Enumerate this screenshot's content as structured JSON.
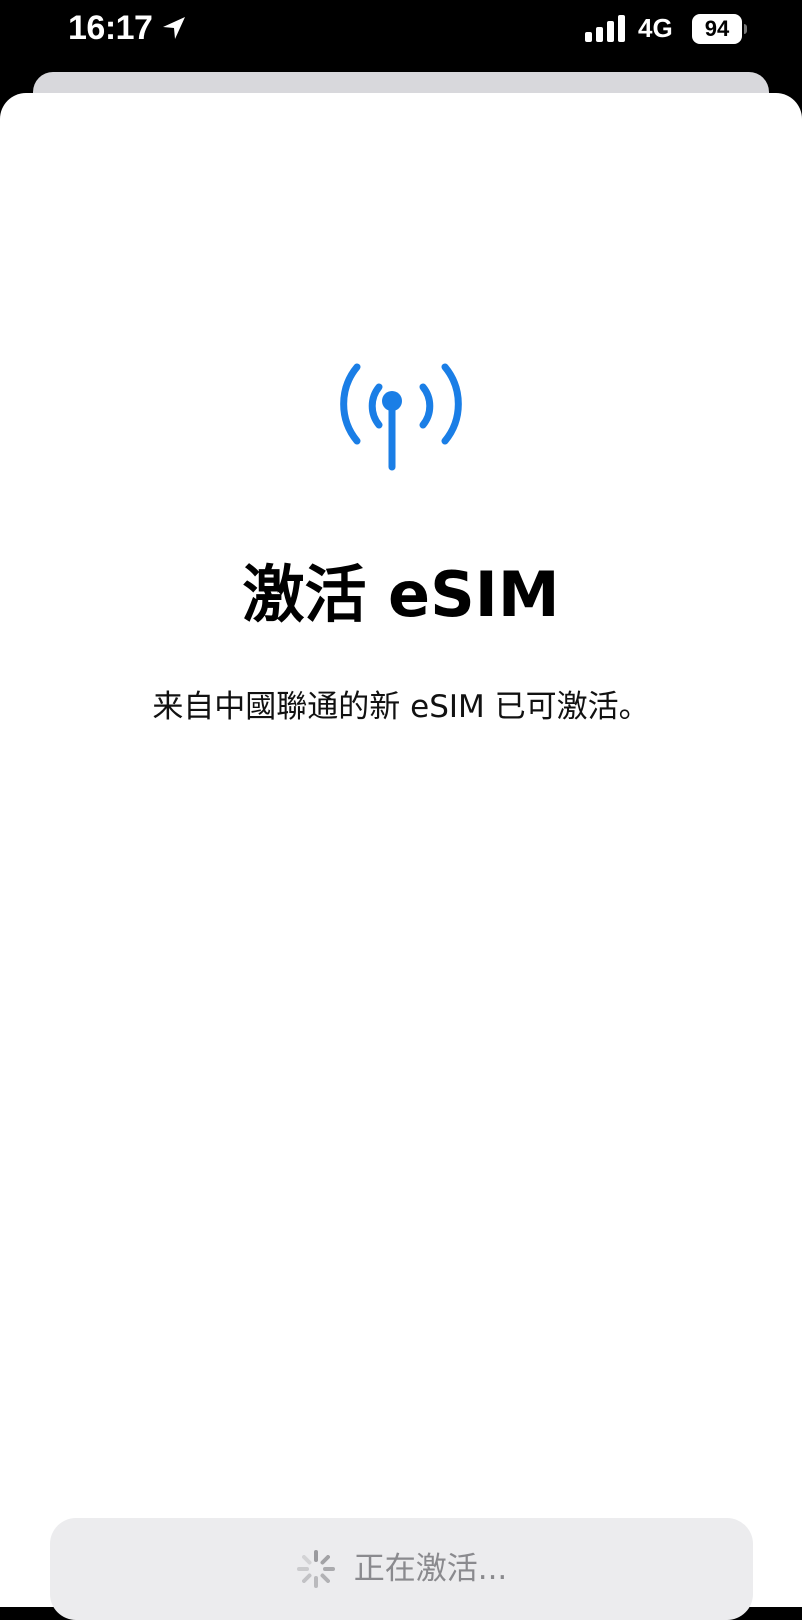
{
  "status_bar": {
    "time": "16:17",
    "network_type": "4G",
    "battery_level": "94",
    "icons": [
      "location-arrow-icon",
      "cellular-signal-icon",
      "battery-icon"
    ]
  },
  "main": {
    "icon": "antenna-broadcast-icon",
    "title": "激活 eSIM",
    "subtitle": "来自中國聯通的新 eSIM 已可激活。",
    "button": {
      "label": "正在激活...",
      "icon": "spinner-icon"
    }
  },
  "colors": {
    "accent": "#1a7ee6",
    "button_bg": "#ececee",
    "button_text": "#8a8a8e"
  }
}
